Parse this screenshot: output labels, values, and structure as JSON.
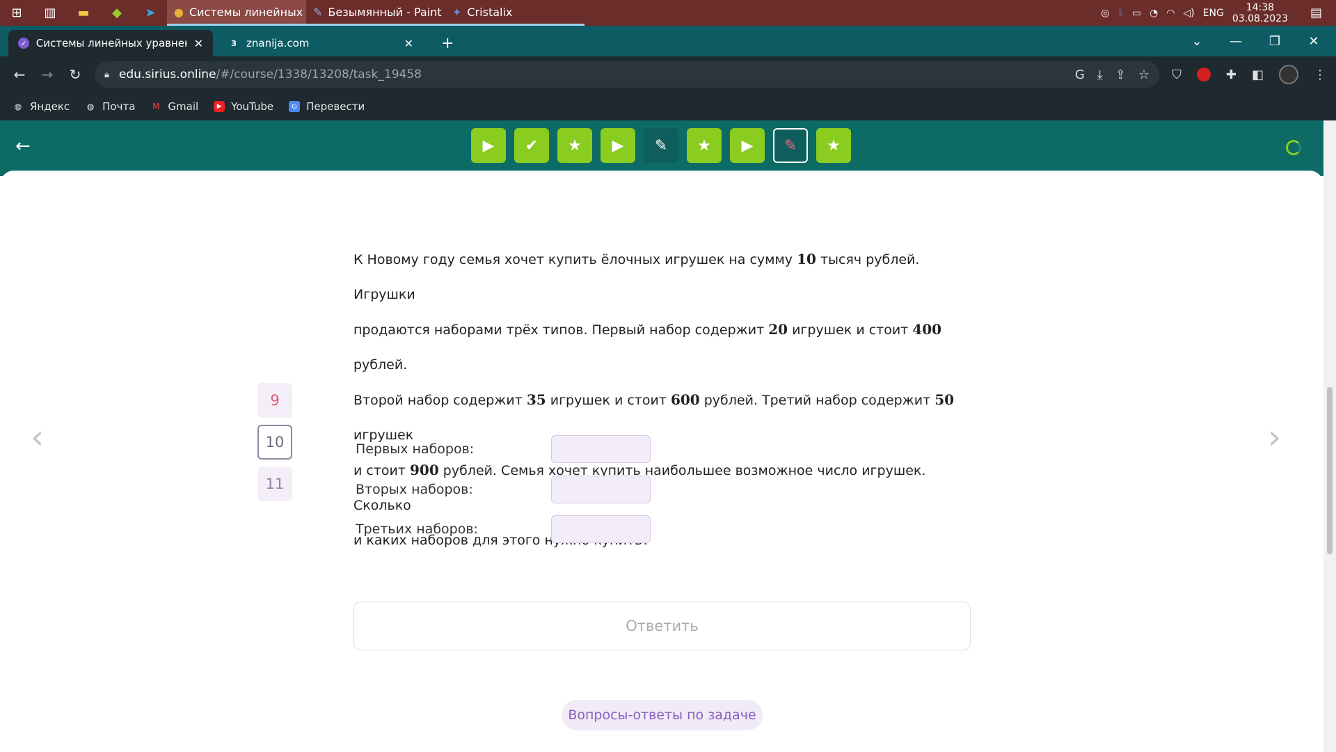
{
  "taskbar": {
    "apps": [
      {
        "label": "Системы линейных ...",
        "icon": "chrome-icon"
      },
      {
        "label": "Безымянный - Paint",
        "icon": "paint-icon"
      },
      {
        "label": "Cristalix",
        "icon": "cristalix-icon"
      }
    ],
    "tray": {
      "language": "ENG",
      "time": "14:38",
      "date": "03.08.2023"
    }
  },
  "browser": {
    "tabs": [
      {
        "title": "Системы линейных уравнений",
        "favicon": "sirius-icon"
      },
      {
        "title": "znanija.com",
        "favicon": "znanija-icon",
        "favicon_text": "З"
      }
    ],
    "url_host": "edu.sirius.online",
    "url_path": "/#/course/1338/13208/task_19458",
    "bookmarks": [
      {
        "label": "Яндекс",
        "icon": "globe-icon"
      },
      {
        "label": "Почта",
        "icon": "globe-icon"
      },
      {
        "label": "Gmail",
        "icon": "gmail-icon"
      },
      {
        "label": "YouTube",
        "icon": "youtube-icon"
      },
      {
        "label": "Перевести",
        "icon": "translate-icon"
      }
    ]
  },
  "task_strip": [
    {
      "icon": "play-icon",
      "state": "done"
    },
    {
      "icon": "check-icon",
      "state": "done"
    },
    {
      "icon": "star-icon",
      "state": "done"
    },
    {
      "icon": "play-icon",
      "state": "done"
    },
    {
      "icon": "pencil-icon",
      "state": "pending"
    },
    {
      "icon": "star-icon",
      "state": "done"
    },
    {
      "icon": "play-icon",
      "state": "done"
    },
    {
      "icon": "pencil-icon",
      "state": "current"
    },
    {
      "icon": "star-icon",
      "state": "done"
    }
  ],
  "problem_nav": {
    "prev": "9",
    "current": "10",
    "next": "11"
  },
  "problem": {
    "lines": [
      [
        "К Новому году семья хочет купить ёлочных игрушек на сумму ",
        "10",
        " тысяч рублей. Игрушки"
      ],
      [
        "продаются наборами трёх типов. Первый набор содержит ",
        "20",
        " игрушек и стоит ",
        "400",
        " рублей."
      ],
      [
        "Второй набор содержит ",
        "35",
        " игрушек и стоит ",
        "600",
        " рублей. Третий набор содержит ",
        "50",
        " игрушек"
      ],
      [
        "и стоит ",
        "900",
        " рублей. Семья хочет купить наибольшее возможное число игрушек. Сколько"
      ],
      [
        "и каких наборов для этого нужно купить?"
      ]
    ]
  },
  "fields": [
    {
      "label": "Первых наборов:",
      "value": ""
    },
    {
      "label": "Вторых наборов:",
      "value": ""
    },
    {
      "label": "Третьих наборов:",
      "value": ""
    }
  ],
  "answer_label": "Ответить",
  "qa_label": "Вопросы-ответы по задаче",
  "colors": {
    "header": "#0d6b66",
    "done": "#8acc20",
    "current_accent": "#f0627b",
    "accent_purple": "#8a5fc0"
  }
}
